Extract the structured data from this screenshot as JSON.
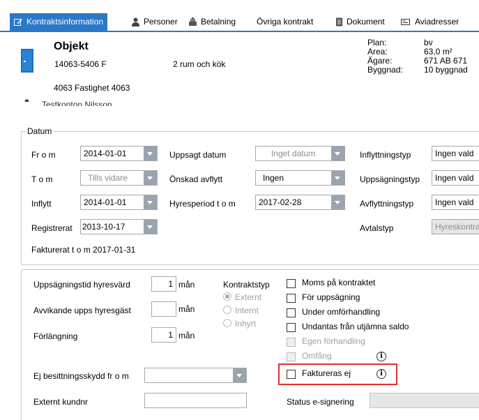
{
  "tabs": [
    {
      "label": "Kontraktsinformation",
      "icon": "edit-icon",
      "active": true
    },
    {
      "label": "Personer",
      "icon": "person-icon"
    },
    {
      "label": "Betalning",
      "icon": "cash-register-icon"
    },
    {
      "label": "Övriga kontrakt"
    },
    {
      "label": "Dokument",
      "icon": "document-icon"
    },
    {
      "label": "Aviadresser",
      "icon": "address-card-icon"
    }
  ],
  "header": {
    "title": "Objekt",
    "object_id": "14063-5406 F",
    "object_desc": "2 rum och kök",
    "property": "4063 Fastighet 4063",
    "info": {
      "plan_label": "Plan:",
      "plan_value": "bv",
      "area_label": "Area:",
      "area_value": "63,0 m²",
      "owner_label": "Ägare:",
      "owner_value": "671 AB 671",
      "building_label": "Byggnad:",
      "building_value": "10 byggnad"
    },
    "person_name": "Testkonton Nilsson"
  },
  "datum": {
    "title": "Datum",
    "from_label": "Fr o m",
    "from_value": "2014-01-01",
    "tom_label": "T o m",
    "tom_value": "Tills vidare",
    "inflytt_label": "Inflytt",
    "inflytt_value": "2014-01-01",
    "registrerat_label": "Registrerat",
    "registrerat_value": "2013-10-17",
    "uppsagt_label": "Uppsagt datum",
    "uppsagt_value": "Inget datum",
    "onskad_label": "Önskad avflytt",
    "onskad_value": "Ingen",
    "hyresperiod_label": "Hyresperiod t o m",
    "hyresperiod_value": "2017-02-28",
    "inflyttningstyp_label": "Inflyttningstyp",
    "inflyttningstyp_value": "Ingen vald",
    "uppsagningstyp_label": "Uppsägningstyp",
    "uppsagningstyp_value": "Ingen vald",
    "avflyttningstyp_label": "Avflyttningstyp",
    "avflyttningstyp_value": "Ingen vald",
    "avtalstyp_label": "Avtalstyp",
    "avtalstyp_value": "Hyreskontrakt",
    "fakturerat": "Fakturerat t o m 2017-01-31"
  },
  "terms": {
    "uppsagningstid_label": "Uppsägningstid hyresvärd",
    "uppsagningstid_value": "1",
    "uppsagningstid_unit": "mån",
    "avvikande_label": "Avvikande upps hyresgäst",
    "avvikande_value": "",
    "avvikande_unit": "mån",
    "forlangning_label": "Förlängning",
    "forlangning_value": "1",
    "forlangning_unit": "mån",
    "kontraktstyp_label": "Kontraktstyp",
    "radio": [
      "Externt",
      "Internt",
      "Inhyrt"
    ],
    "checkboxes": [
      "Moms på kontraktet",
      "För uppsägning",
      "Under omförhandling",
      "Undantas från utjämna saldo",
      "Egen förhandling",
      "Omfång"
    ],
    "faktureras_ej": "Faktureras ej",
    "ej_besittning_label": "Ej besittningsskydd fr o m",
    "ej_besittning_value": "",
    "externt_kundnr_label": "Externt kundnr",
    "externt_kundnr_value": "",
    "status_esign_label": "Status e-signering",
    "status_esign_value": ""
  },
  "info_glyph": "i",
  "colors": {
    "tab_active": "#2b78c8",
    "highlight": "#e03030"
  }
}
